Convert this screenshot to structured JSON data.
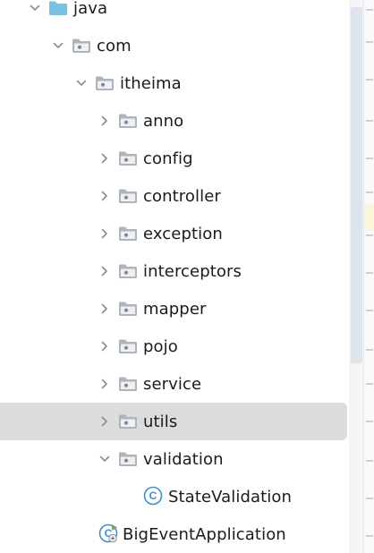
{
  "tree": {
    "items": [
      {
        "label": "java",
        "depth": 0,
        "kind": "source-folder",
        "expanded": true,
        "selected": false
      },
      {
        "label": "com",
        "depth": 1,
        "kind": "package",
        "expanded": true,
        "selected": false
      },
      {
        "label": "itheima",
        "depth": 2,
        "kind": "package",
        "expanded": true,
        "selected": false
      },
      {
        "label": "anno",
        "depth": 3,
        "kind": "package",
        "expanded": false,
        "selected": false
      },
      {
        "label": "config",
        "depth": 3,
        "kind": "package",
        "expanded": false,
        "selected": false
      },
      {
        "label": "controller",
        "depth": 3,
        "kind": "package",
        "expanded": false,
        "selected": false
      },
      {
        "label": "exception",
        "depth": 3,
        "kind": "package",
        "expanded": false,
        "selected": false
      },
      {
        "label": "interceptors",
        "depth": 3,
        "kind": "package",
        "expanded": false,
        "selected": false
      },
      {
        "label": "mapper",
        "depth": 3,
        "kind": "package",
        "expanded": false,
        "selected": false
      },
      {
        "label": "pojo",
        "depth": 3,
        "kind": "package",
        "expanded": false,
        "selected": false
      },
      {
        "label": "service",
        "depth": 3,
        "kind": "package",
        "expanded": false,
        "selected": false
      },
      {
        "label": "utils",
        "depth": 3,
        "kind": "package",
        "expanded": false,
        "selected": true
      },
      {
        "label": "validation",
        "depth": 3,
        "kind": "package",
        "expanded": true,
        "selected": false
      },
      {
        "label": "StateValidation",
        "depth": 4,
        "kind": "class",
        "selected": false
      },
      {
        "label": "BigEventApplication",
        "depth": 3,
        "kind": "spring-app-class",
        "selected": false
      }
    ]
  },
  "colors": {
    "source_folder": "#7dc0e0",
    "package_folder": "#aeb4bc",
    "chevron": "#8c8c8c",
    "class_icon": "#3d8fc7",
    "spring_badge": "#6aab57",
    "selection_bg": "#dcdcdc"
  },
  "icons": {
    "source-folder": "folder-icon",
    "package": "package-folder-icon",
    "class": "java-class-icon",
    "spring-app-class": "spring-boot-class-icon",
    "expanded": "chevron-down-icon",
    "collapsed": "chevron-right-icon"
  }
}
